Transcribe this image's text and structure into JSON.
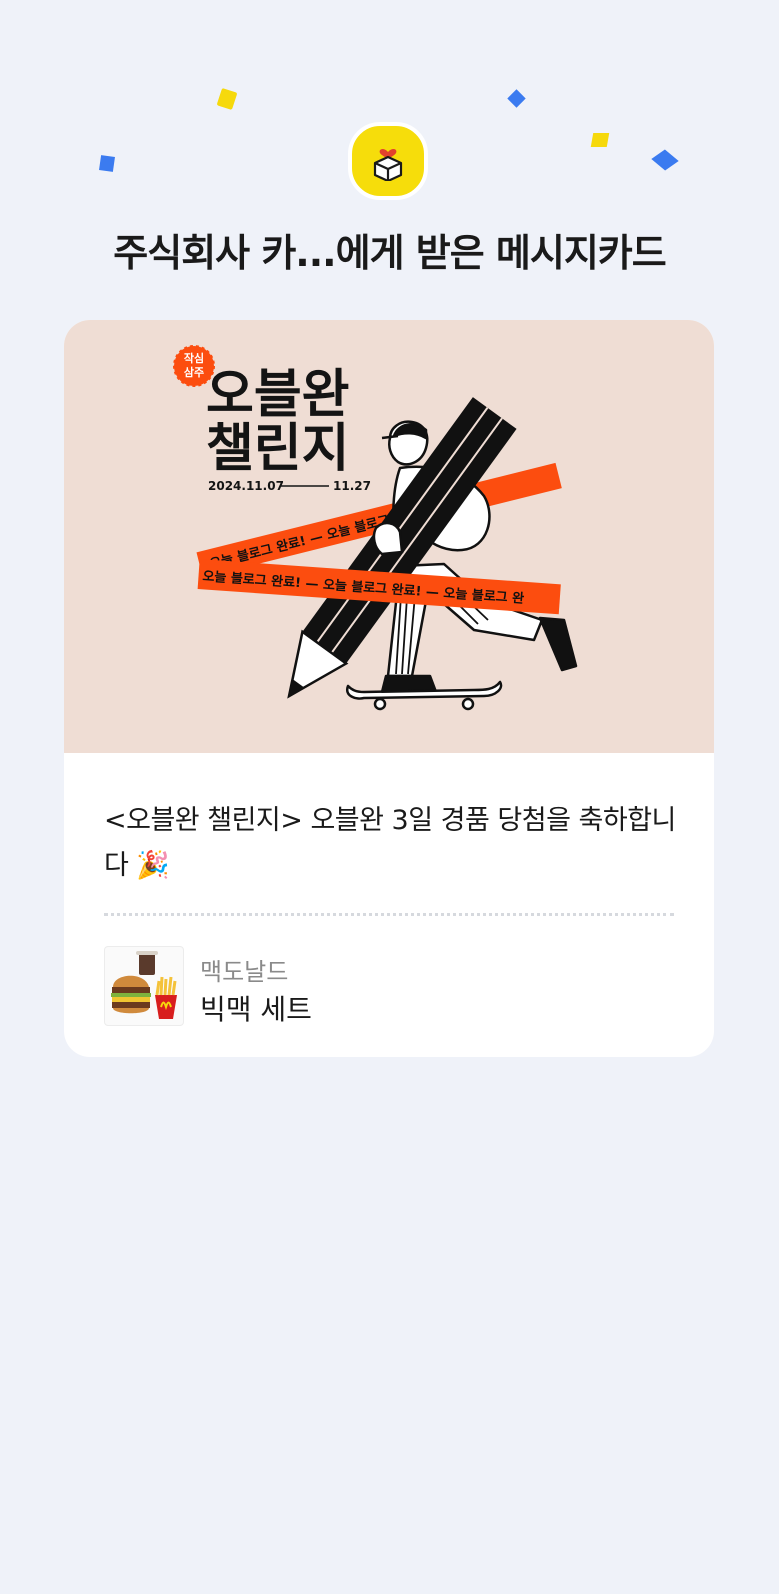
{
  "header": {
    "title": "주식회사 카...에게 받은 메시지카드",
    "badge_icon": "gift-box-heart-icon",
    "badge_color": "#f6dd0b"
  },
  "card": {
    "banner": {
      "badge_line1": "작심",
      "badge_line2": "삼주",
      "headline_line1": "오블완",
      "headline_line2": "챌린지",
      "date_start": "2024.11.07",
      "date_end": "11.27",
      "ribbon_text": "오늘 블로그 완료! — 오늘 블로그 완료! — 오늘 블로그 완",
      "ribbon_text_upper": "오늘 블로그 완료! — 오늘 블로그 완료!",
      "ribbon_color": "#fc4d0f",
      "background_color": "#efddd4"
    },
    "message": "<오블완 챌린지> 오블완 3일 경품 당첨을 축하합니다 🎉",
    "product": {
      "brand": "맥도날드",
      "name": "빅맥 세트",
      "thumbnail_icon": "bigmac-set-image"
    }
  }
}
